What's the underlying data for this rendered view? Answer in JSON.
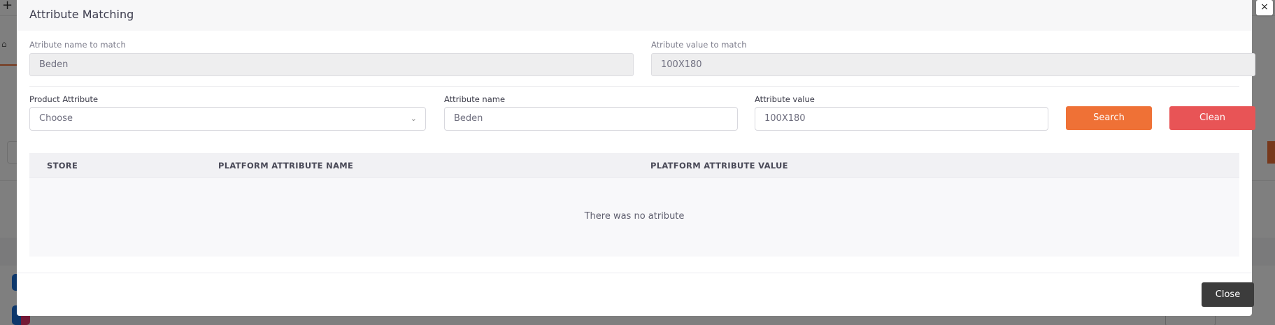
{
  "modal": {
    "title": "Attribute Matching",
    "close_icon": "close-icon",
    "close_glyph": "×",
    "match_name_label": "Atribute name to match",
    "match_name_value": "Beden",
    "match_value_label": "Atribute value to match",
    "match_value_value": "100X180",
    "product_attribute_label": "Product Attribute",
    "product_attribute_selected": "Choose",
    "attribute_name_label": "Attribute name",
    "attribute_name_value": "Beden",
    "attribute_value_label": "Attribute value",
    "attribute_value_value": "100X180",
    "search_label": "Search",
    "clean_label": "Clean",
    "table": {
      "columns": [
        "STORE",
        "PLATFORM ATTRIBUTE NAME",
        "PLATFORM ATTRIBUTE VALUE"
      ],
      "empty_message": "There was no atribute"
    },
    "footer_close_label": "Close"
  },
  "colors": {
    "accent_orange": "#ef7136",
    "clean_red": "#e85456",
    "close_dark": "#3c3c3c"
  }
}
